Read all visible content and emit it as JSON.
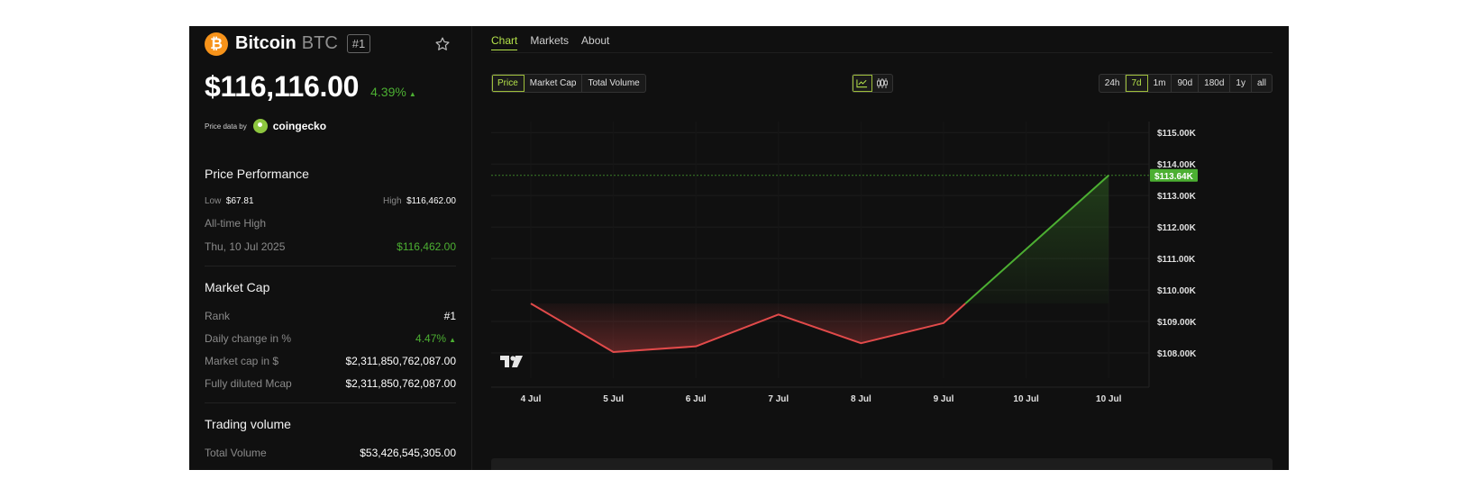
{
  "coin": {
    "logo_glyph": "₿",
    "name": "Bitcoin",
    "symbol": "BTC",
    "rank_badge": "#1",
    "price": "$116,116.00",
    "change": "4.39%",
    "change_arrow": "▲",
    "price_data_label": "Price data by",
    "provider": "coingecko"
  },
  "performance": {
    "title": "Price Performance",
    "low_label": "Low",
    "low_value": "$67.81",
    "high_label": "High",
    "high_value": "$116,462.00",
    "ath_label": "All-time High",
    "ath_date": "Thu, 10 Jul 2025",
    "ath_value": "$116,462.00"
  },
  "market_cap": {
    "title": "Market Cap",
    "rank_label": "Rank",
    "rank_value": "#1",
    "daily_label": "Daily change in %",
    "daily_value": "4.47%",
    "daily_arrow": "▲",
    "mcap_label": "Market cap in $",
    "mcap_value": "$2,311,850,762,087.00",
    "fdv_label": "Fully diluted Mcap",
    "fdv_value": "$2,311,850,762,087.00"
  },
  "volume": {
    "title": "Trading volume",
    "total_label": "Total Volume",
    "total_value": "$53,426,545,305.00"
  },
  "tabs": [
    {
      "label": "Chart",
      "active": true
    },
    {
      "label": "Markets",
      "active": false
    },
    {
      "label": "About",
      "active": false
    }
  ],
  "chart_types": [
    {
      "label": "Price",
      "active": true
    },
    {
      "label": "Market Cap",
      "active": false
    },
    {
      "label": "Total Volume",
      "active": false
    }
  ],
  "view_modes": [
    {
      "icon": "line-chart-icon",
      "active": true
    },
    {
      "icon": "candlestick-icon",
      "active": false
    }
  ],
  "ranges": [
    {
      "label": "24h",
      "active": false
    },
    {
      "label": "7d",
      "active": true
    },
    {
      "label": "1m",
      "active": false
    },
    {
      "label": "90d",
      "active": false
    },
    {
      "label": "180d",
      "active": false
    },
    {
      "label": "1y",
      "active": false
    },
    {
      "label": "all",
      "active": false
    }
  ],
  "colors": {
    "up": "#4caf32",
    "down": "#e14a4a",
    "accent": "#b4e24a",
    "bitcoin": "#f7931a"
  },
  "chart_data": {
    "type": "line",
    "x_labels": [
      "4 Jul",
      "5 Jul",
      "6 Jul",
      "7 Jul",
      "8 Jul",
      "9 Jul",
      "10 Jul",
      "10 Jul"
    ],
    "points": [
      {
        "x": "4 Jul",
        "y": 109570
      },
      {
        "x": "5 Jul",
        "y": 108030
      },
      {
        "x": "6 Jul",
        "y": 108210
      },
      {
        "x": "7 Jul",
        "y": 109220
      },
      {
        "x": "8 Jul",
        "y": 108310
      },
      {
        "x": "9 Jul",
        "y": 108950
      },
      {
        "x": "10 Jul",
        "y": 113640
      }
    ],
    "baseline": 109570,
    "y_ticks": [
      108000,
      109000,
      110000,
      111000,
      112000,
      113000,
      114000,
      115000
    ],
    "y_tick_labels": [
      "$108.00K",
      "$109.00K",
      "$110.00K",
      "$111.00K",
      "$112.00K",
      "$113.00K",
      "$114.00K",
      "$115.00K"
    ],
    "ylim": [
      107200,
      115350
    ],
    "current_label": "$113.64K",
    "axis_side": "right",
    "grid": true,
    "watermark": "tradingview-logo-icon"
  }
}
